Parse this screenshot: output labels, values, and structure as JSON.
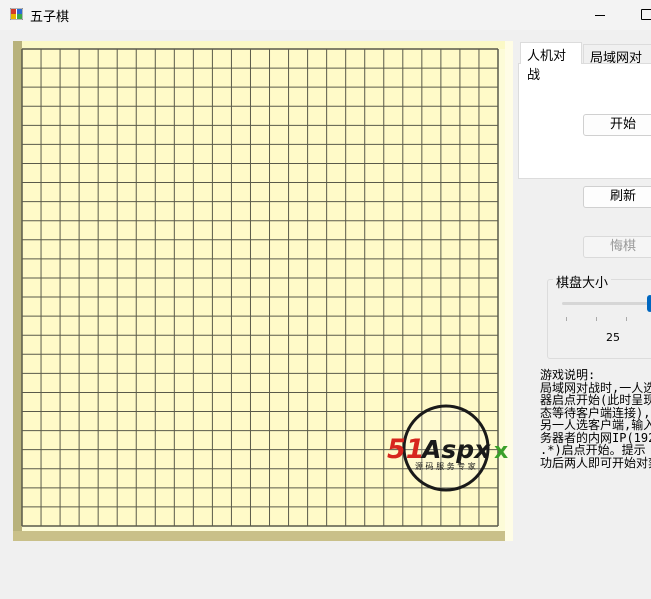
{
  "window": {
    "title": "五子棋",
    "icon": "gomoku-app-icon"
  },
  "board": {
    "size": 25,
    "colors": {
      "background": "#fffac8",
      "line": "#5a5a4a"
    }
  },
  "tabs": [
    {
      "label": "人机对战",
      "active": true
    },
    {
      "label": "局域网对战",
      "active": false
    }
  ],
  "buttons": {
    "start": "开始",
    "refresh": "刷新",
    "undo": "悔棋"
  },
  "board_size_group": {
    "label": "棋盘大小",
    "value": "25"
  },
  "help": {
    "text": "游戏说明:\n局域网对战时,一人选\n器启点开始(此时呈现\n态等待客户端连接),\n另一人选客户端,输入\n务器者的内网IP(192.\n.*)启点开始。提示\n功后两人即可开始对弈"
  },
  "watermark": {
    "brand": "51Aspx",
    "slogan": "源码服务专家"
  }
}
